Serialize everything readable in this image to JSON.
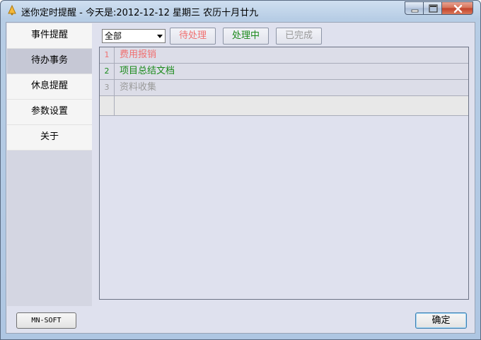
{
  "window": {
    "title": "迷你定时提醒 - 今天是:2012-12-12 星期三 农历十月廿九",
    "icon": "bell-icon"
  },
  "sidebar": {
    "items": [
      {
        "label": "事件提醒",
        "active": false
      },
      {
        "label": "待办事务",
        "active": true
      },
      {
        "label": "休息提醒",
        "active": false
      },
      {
        "label": "参数设置",
        "active": false
      },
      {
        "label": "关于",
        "active": false
      }
    ]
  },
  "toolbar": {
    "filter_selected": "全部",
    "pending_label": "待处理",
    "processing_label": "处理中",
    "done_label": "已完成"
  },
  "tasks": {
    "rows": [
      {
        "num": "1",
        "text": "费用报销",
        "status_color": "#f07070"
      },
      {
        "num": "2",
        "text": "项目总结文档",
        "status_color": "#1a8a1a"
      },
      {
        "num": "3",
        "text": "资料收集",
        "status_color": "#9a9a9a"
      }
    ]
  },
  "footer": {
    "brand_label": "MN-SOFT",
    "ok_label": "确定"
  }
}
